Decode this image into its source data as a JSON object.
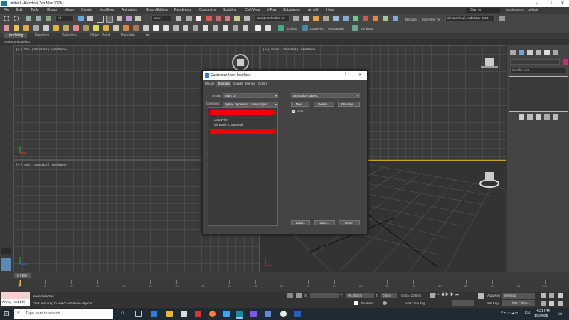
{
  "window": {
    "title": "Untitled - Autodesk 3ds Max 2024",
    "controls": [
      "–",
      "❐",
      "✕"
    ]
  },
  "menu": {
    "items": [
      "File",
      "Edit",
      "Tools",
      "Group",
      "Views",
      "Create",
      "Modifiers",
      "Animation",
      "Graph Editors",
      "Rendering",
      "Customize",
      "Scripting",
      "Civil View",
      "V-Ray",
      "Substance",
      "Arnold",
      "Help"
    ],
    "sign_in": "Sign in",
    "workspaces_label": "Workspaces:",
    "workspaces_value": "Default"
  },
  "toolbar": {
    "filter_dropdown": "All",
    "view_dropdown": "View",
    "selection_set": "Create Selection Se",
    "labels": [
      "3Dinfos",
      "DataWire",
      "Woodworks",
      "Ventilator",
      "3Dmaps",
      "Isometric Te"
    ],
    "path_dropdown": "C:\\Users\\Aa\\...3ds Max 2024"
  },
  "ribbon": {
    "tabs": [
      "Modeling",
      "Freeform",
      "Selection",
      "Object Paint",
      "Populate"
    ],
    "sub_label": "Polygon Modeling"
  },
  "viewports": {
    "top_left": "[ + ] [ Top ] [ Standard ] [ Wireframe ]",
    "top_right": "[ + ] [ Front ] [ Standard ] [ Wireframe ]",
    "bottom_left": "[ + ] [ Left ] [ Standard ] [ Wireframe ]"
  },
  "command_panel": {
    "modifier_list": "Modifier List"
  },
  "dialog": {
    "title": "Customize User Interface",
    "help": "?",
    "close": "✕",
    "tabs": [
      "Mouse",
      "Toolbars",
      "Quads",
      "Menus",
      "Colors"
    ],
    "active_tab": "Toolbars",
    "group_label": "Group:",
    "group_value": "Main UI",
    "category_label": "Category:",
    "category_value": "Spline Dynamics - free scripts",
    "list_items": [
      "DataWire",
      "Wireable to Material"
    ],
    "toolbar_dropdown": "Animation Layers",
    "new_button": "New...",
    "delete_button": "Delete...",
    "rename_button": "Rename...",
    "hide_checkbox": "Hide",
    "load_button": "Load...",
    "save_button": "Save...",
    "reset_button": "Reset"
  },
  "timeline": {
    "frame_display": "0 / 100",
    "ticks": [
      "0",
      "5",
      "10",
      "15",
      "20",
      "25",
      "30",
      "35",
      "40",
      "45",
      "50",
      "55",
      "60",
      "65",
      "70",
      "75",
      "80",
      "85",
      "90",
      "95",
      "100"
    ]
  },
  "status": {
    "script_field": "Array modifi",
    "selection": "None Selected",
    "prompt": "Click and drag to select and move objects",
    "x_label": "X:",
    "y_label": "Y:",
    "y_value": "-95.882cm",
    "z_label": "Z:",
    "z_value": "0.0cm",
    "grid": "Grid = 10.0cm",
    "enabled_label": "Enabled:",
    "add_time_tag": "Add Time Tag",
    "auto_key": "Auto Key",
    "selected_dropdown": "Selected",
    "set_key": "Set Key",
    "key_filters": "Key Filters..."
  },
  "taskbar": {
    "search_placeholder": "Type here to search",
    "language": "EN",
    "time": "4:21 PM",
    "date": "1/3/2025"
  }
}
